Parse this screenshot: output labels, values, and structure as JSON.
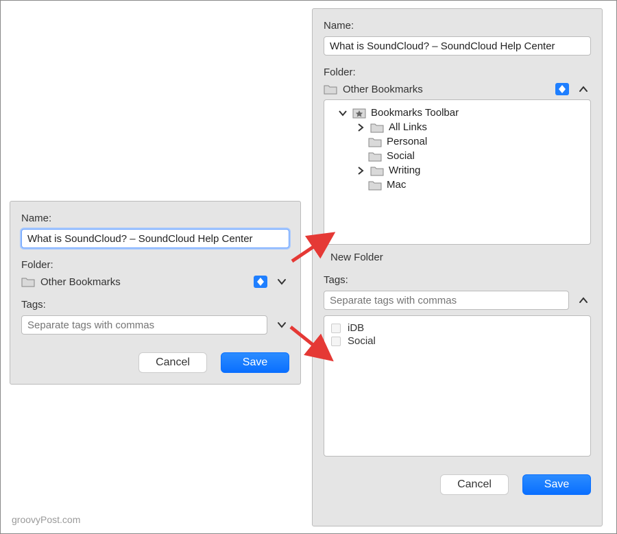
{
  "left": {
    "name_label": "Name:",
    "name_value": "What is SoundCloud? – SoundCloud Help Center",
    "folder_label": "Folder:",
    "folder_selected": "Other Bookmarks",
    "tags_label": "Tags:",
    "tags_placeholder": "Separate tags with commas",
    "cancel": "Cancel",
    "save": "Save"
  },
  "right": {
    "name_label": "Name:",
    "name_value": "What is SoundCloud? – SoundCloud Help Center",
    "folder_label": "Folder:",
    "folder_selected": "Other Bookmarks",
    "tree": {
      "root": "Bookmarks Toolbar",
      "items": {
        "all_links": "All Links",
        "personal": "Personal",
        "social": "Social",
        "writing": "Writing",
        "mac": "Mac"
      }
    },
    "new_folder": "New Folder",
    "tags_label": "Tags:",
    "tags_placeholder": "Separate tags with commas",
    "tags": {
      "0": "iDB",
      "1": "Social"
    },
    "cancel": "Cancel",
    "save": "Save"
  },
  "watermark": "groovyPost.com"
}
